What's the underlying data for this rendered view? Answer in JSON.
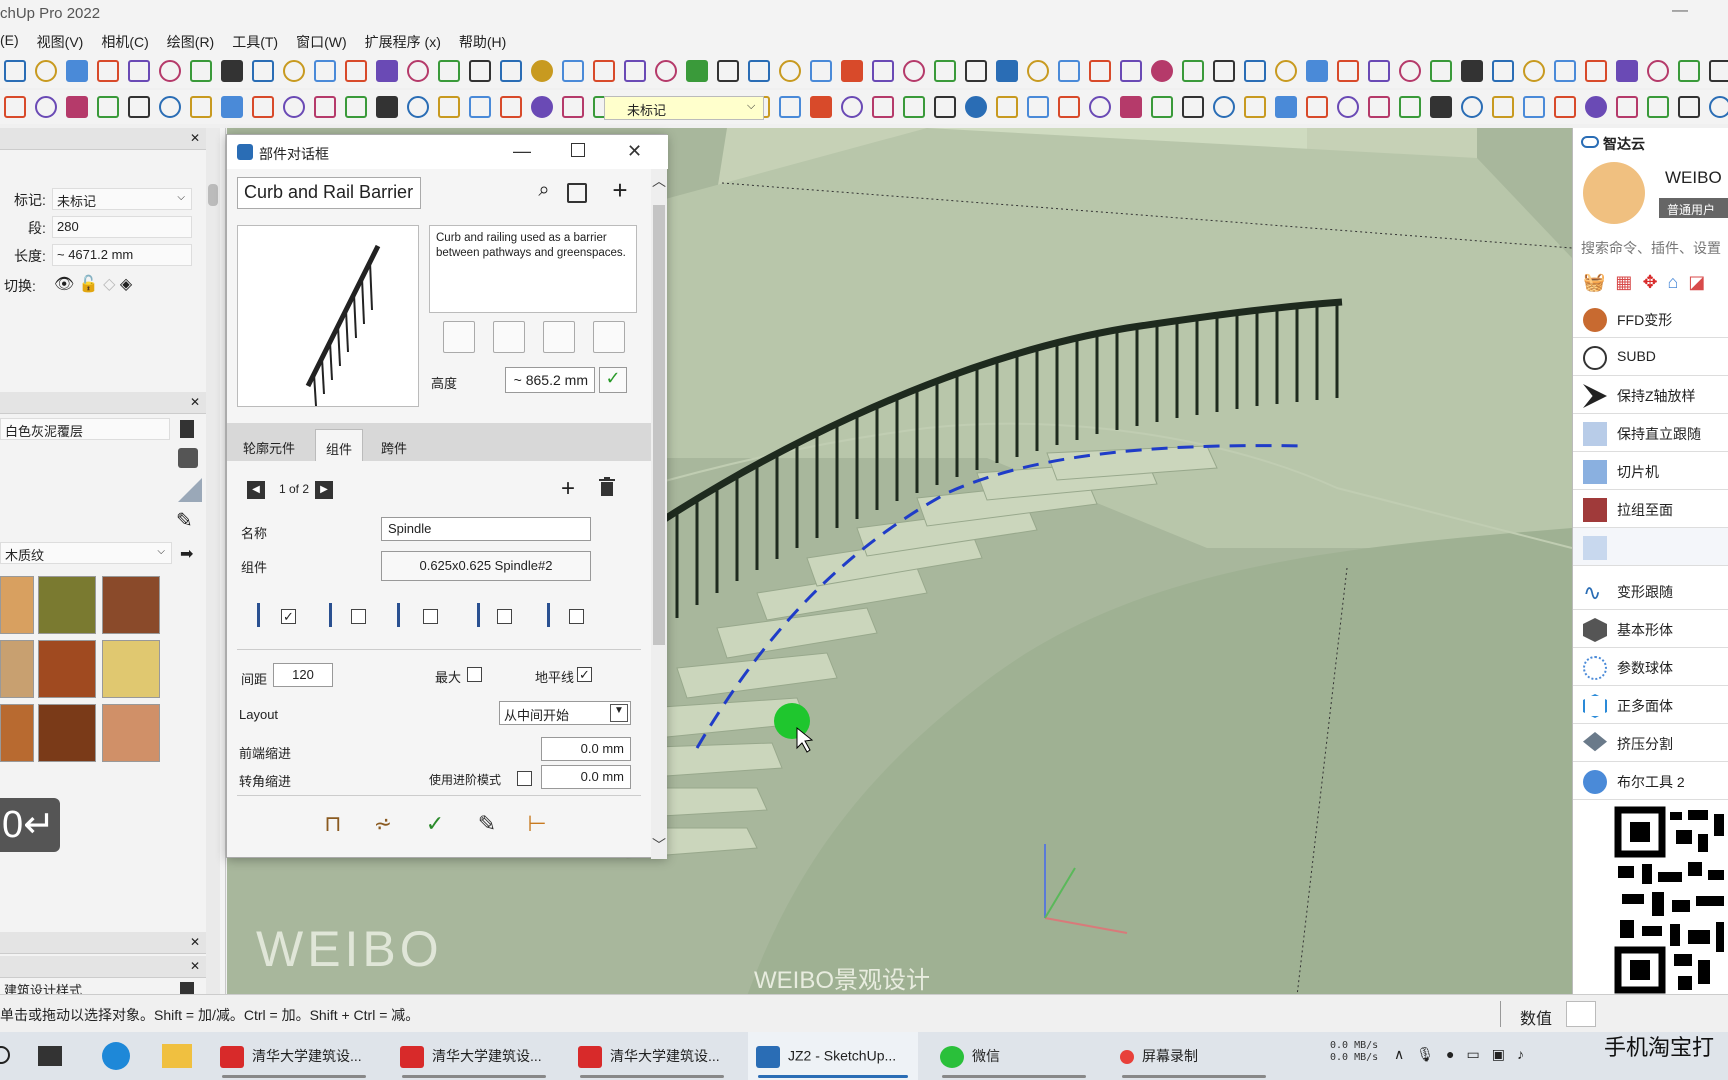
{
  "app": {
    "title": "chUp Pro 2022",
    "minimize": "—"
  },
  "menu": [
    "(E)",
    "视图(V)",
    "相机(C)",
    "绘图(R)",
    "工具(T)",
    "窗口(W)",
    "扩展程序 (x)",
    "帮助(H)"
  ],
  "toolbar": {
    "tag_dropdown": "未标记"
  },
  "entity_info": {
    "tag_label": "标记:",
    "tag_value": "未标记",
    "segments_label": "段:",
    "segments_value": "280",
    "length_label": "长度:",
    "length_value": "~ 4671.2 mm",
    "toggle_label": "切换:"
  },
  "materials": {
    "current_material": "白色灰泥覆层",
    "library": "木质纹"
  },
  "styles": {
    "current_style": "建筑设计样式"
  },
  "vcb_hint": "0↵",
  "dialog": {
    "title": "部件对话框",
    "search_value": "Curb and Rail Barrier",
    "description": "Curb and railing used as a barrier between pathways and greenspaces.",
    "height_label": "高度",
    "height_value": "~ 865.2 mm",
    "tabs": [
      "轮廓元件",
      "组件",
      "跨件"
    ],
    "active_tab": 1,
    "pager": "1 of 2",
    "name_label": "名称",
    "name_value": "Spindle",
    "component_label": "组件",
    "component_value": "0.625x0.625 Spindle#2",
    "spacing_label": "间距",
    "spacing_value": "120",
    "max_label": "最大",
    "horizon_label": "地平线",
    "layout_label": "Layout",
    "layout_value": "从中间开始",
    "front_inset_label": "前端缩进",
    "front_inset_value": "0.0 mm",
    "corner_inset_label": "转角缩进",
    "step_mode_label": "使用进阶模式",
    "corner_inset_value": "0.0 mm"
  },
  "viewport": {
    "watermark": "WEIBO",
    "watermark_small": "WEIBO景观设计"
  },
  "right_panel": {
    "brand": "智达云",
    "username": "WEIBO",
    "badge": "普通用户",
    "search_placeholder": "搜索命令、插件、设置",
    "tools": [
      "FFD变形",
      "SUBD",
      "保持Z轴放样",
      "保持直立跟随",
      "切片机",
      "拉组至面",
      "",
      "变形跟随",
      "基本形体",
      "参数球体",
      "正多面体",
      "挤压分割",
      "布尔工具 2"
    ]
  },
  "status": {
    "hint": "单击或拖动以选择对象。Shift = 加/减。Ctrl = 加。Shift + Ctrl = 减。",
    "vcb_label": "数值"
  },
  "taskbar": {
    "items": [
      "清华大学建筑设...",
      "清华大学建筑设...",
      "清华大学建筑设...",
      "JZ2 - SketchUp...",
      "微信",
      "屏幕录制"
    ],
    "net_up": "0.0 MB/s",
    "net_down": "0.0 MB/s",
    "promo": "手机淘宝打"
  },
  "colors": {
    "accent": "#2a6db5",
    "viewport_bg": "#a6b59a",
    "cursor_dot": "#1fc62e",
    "path_line": "#1f3cc8"
  }
}
